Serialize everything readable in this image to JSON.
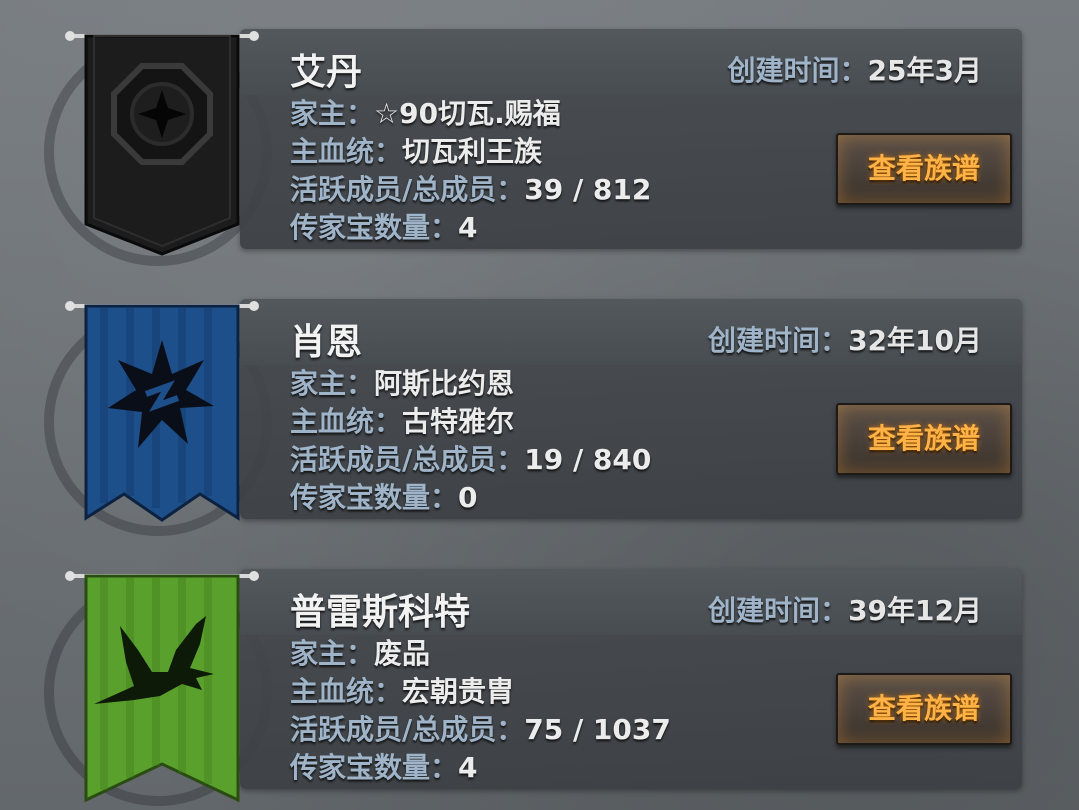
{
  "labels": {
    "created": "创建时间：",
    "head": "家主：",
    "bloodline": "主血统：",
    "members": "活跃成员/总成员：",
    "heirlooms": "传家宝数量：",
    "view_button": "查看族谱"
  },
  "families": [
    {
      "name": "艾丹",
      "created": "25年3月",
      "head": "☆90切瓦.赐福",
      "bloodline": "切瓦利王族",
      "members": "39 / 812",
      "heirlooms": "4",
      "banner_color": "#1c1c1c",
      "banner_icon": "star-emblem-icon"
    },
    {
      "name": "肖恩",
      "created": "32年10月",
      "head": "阿斯比约恩",
      "bloodline": "古特雅尔",
      "members": "19 / 840",
      "heirlooms": "0",
      "banner_color": "#1d4f8a",
      "banner_icon": "burst-emblem-icon"
    },
    {
      "name": "普雷斯科特",
      "created": "39年12月",
      "head": "废品",
      "bloodline": "宏朝贵胄",
      "members": "75 / 1037",
      "heirlooms": "4",
      "banner_color": "#5aa02c",
      "banner_icon": "eagle-emblem-icon"
    }
  ]
}
